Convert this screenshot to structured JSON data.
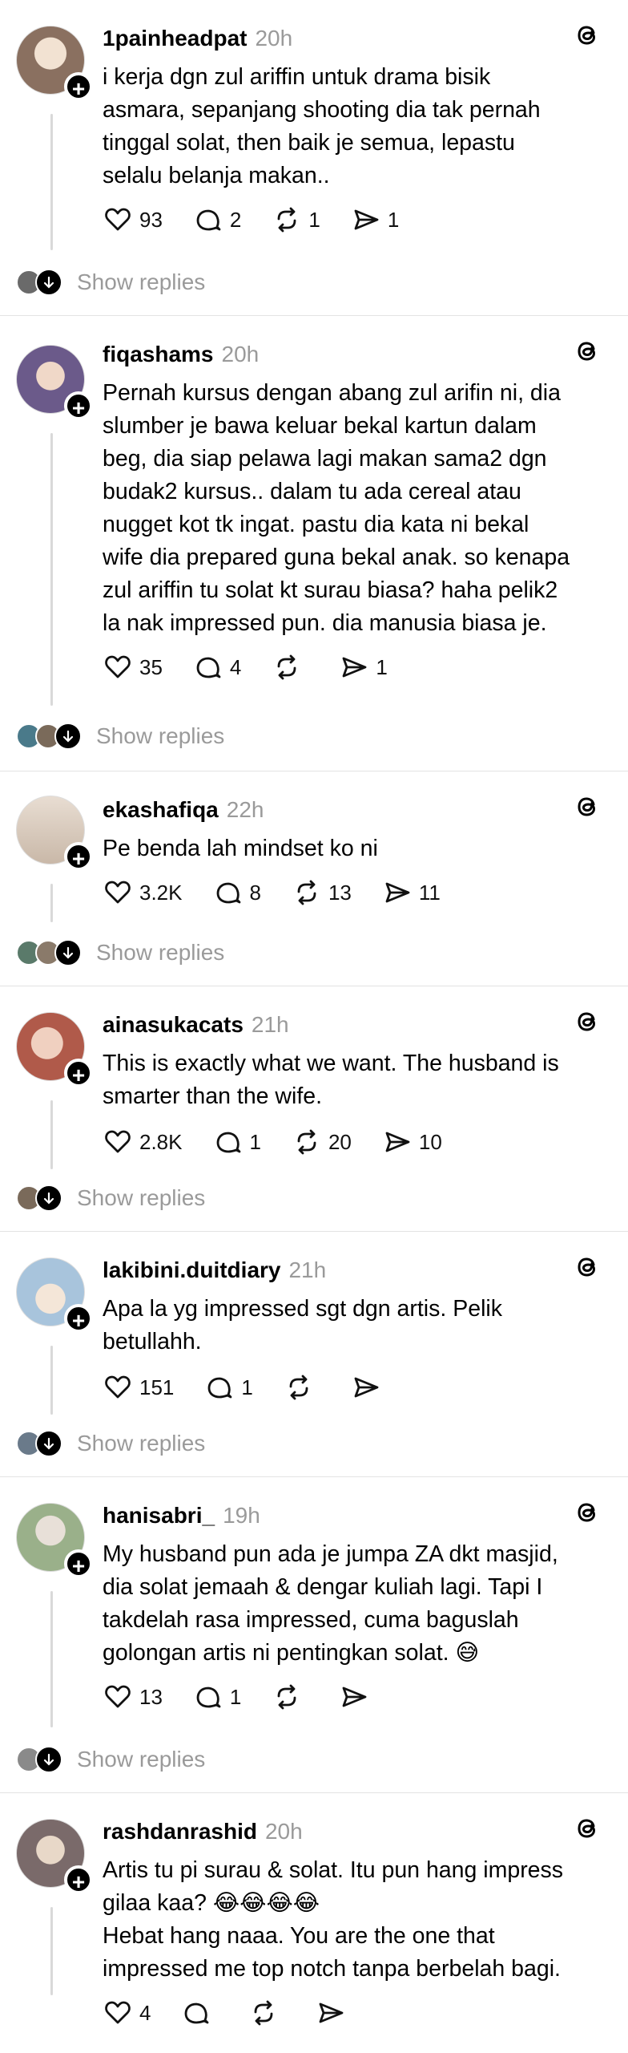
{
  "posts": [
    {
      "username": "1painheadpat",
      "time": "20h",
      "text": "i kerja dgn zul ariffin untuk drama bisik\nasmara, sepanjang shooting dia tak pernah\ntinggal solat, then baik je semua, lepastu\nselalu belanja makan..",
      "likes": "93",
      "comments": "2",
      "reposts": "1",
      "shares": "1",
      "replies_label": "Show replies",
      "avatar_color": "#8a7060",
      "mini_avatars": [
        "#6a6a6a"
      ]
    },
    {
      "username": "fiqashams",
      "time": "20h",
      "text": "Pernah kursus dengan abang zul arifin ni, dia\nslumber je bawa keluar bekal kartun dalam\nbeg, dia siap pelawa lagi makan sama2 dgn\nbudak2 kursus.. dalam tu ada cereal atau\nnugget kot tk ingat. pastu dia kata ni bekal\nwife dia prepared guna bekal anak. so kenapa\nzul ariffin tu solat kt surau biasa? haha pelik2\nla nak impressed pun. dia manusia biasa je.",
      "likes": "35",
      "comments": "4",
      "reposts": "",
      "shares": "1",
      "replies_label": "Show replies",
      "avatar_color": "#6b5a8a",
      "mini_avatars": [
        "#4a7a8a",
        "#7a6a5a"
      ]
    },
    {
      "username": "ekashafiqa",
      "time": "22h",
      "text": "Pe benda lah mindset ko ni",
      "likes": "3.2K",
      "comments": "8",
      "reposts": "13",
      "shares": "11",
      "replies_label": "Show replies",
      "avatar_color": "#c9b8a8",
      "mini_avatars": [
        "#5a7a6a",
        "#8a7a6a"
      ]
    },
    {
      "username": "ainasukacats",
      "time": "21h",
      "text": "This is exactly what we want. The husband is\nsmarter than the wife.",
      "likes": "2.8K",
      "comments": "1",
      "reposts": "20",
      "shares": "10",
      "replies_label": "Show replies",
      "avatar_color": "#b05a4a",
      "mini_avatars": [
        "#7a6a5a"
      ]
    },
    {
      "username": "lakibini.duitdiary",
      "time": "21h",
      "text": "Apa la yg impressed sgt dgn artis. Pelik\nbetullahh.",
      "likes": "151",
      "comments": "1",
      "reposts": "",
      "shares": "",
      "replies_label": "Show replies",
      "avatar_color": "#a8c4dc",
      "mini_avatars": [
        "#6a7a8a"
      ]
    },
    {
      "username": "hanisabri_",
      "time": "19h",
      "text": "My husband pun ada je jumpa ZA dkt masjid,\ndia solat jemaah & dengar kuliah lagi. Tapi I\ntakdelah rasa impressed, cuma baguslah\ngolongan artis ni pentingkan solat. 😅",
      "likes": "13",
      "comments": "1",
      "reposts": "",
      "shares": "",
      "replies_label": "Show replies",
      "avatar_color": "#9ab08a",
      "mini_avatars": [
        "#8a8a8a"
      ]
    },
    {
      "username": "rashdanrashid",
      "time": "20h",
      "text": "Artis tu pi surau & solat. Itu pun hang impress\ngilaa kaa? 😂😂😂😂\nHebat hang naaa. You are the one that\nimpressed me top notch tanpa berbelah bagi.",
      "likes": "4",
      "comments": "",
      "reposts": "",
      "shares": "",
      "replies_label": "",
      "avatar_color": "#7a6a6a",
      "mini_avatars": []
    }
  ]
}
